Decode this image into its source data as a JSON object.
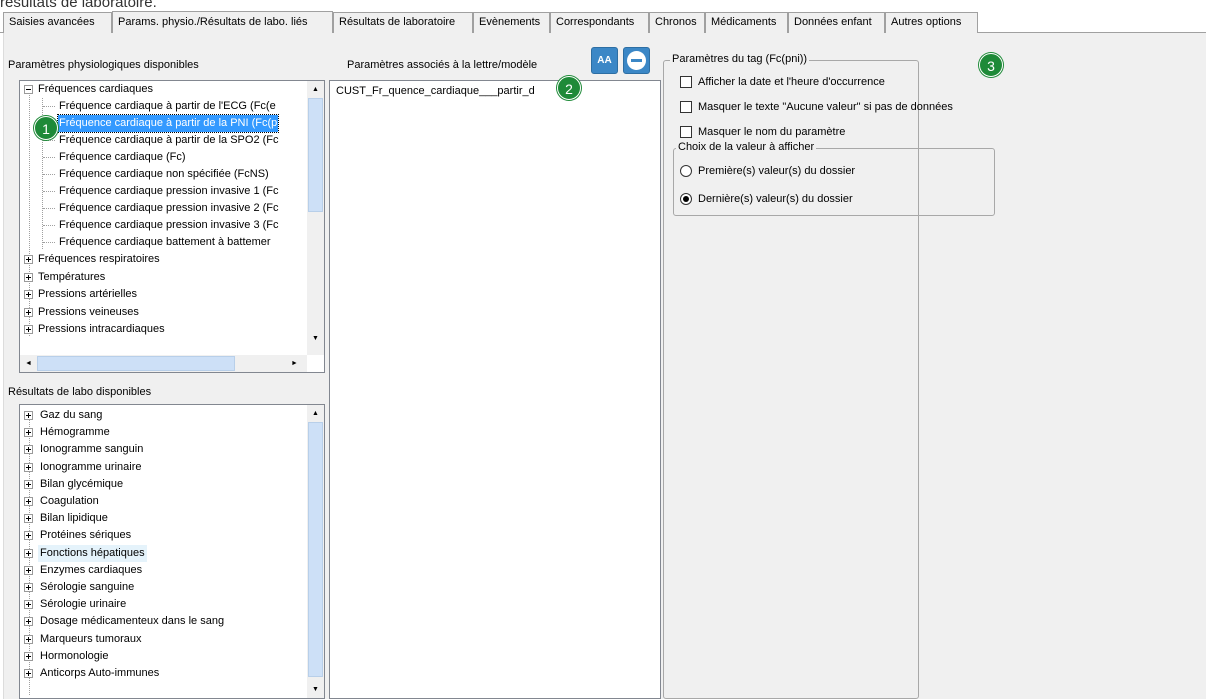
{
  "caption": "résultats de laboratoire.",
  "tabs": [
    {
      "label": "Saisies avancées"
    },
    {
      "label": "Params. physio./Résultats de labo. liés",
      "active": true
    },
    {
      "label": "Résultats de laboratoire"
    },
    {
      "label": "Evènements"
    },
    {
      "label": "Correspondants"
    },
    {
      "label": "Chronos"
    },
    {
      "label": "Médicaments"
    },
    {
      "label": "Données enfant"
    },
    {
      "label": "Autres options"
    }
  ],
  "physio": {
    "title": "Paramètres physiologiques disponibles",
    "expanded_group": "Fréquences cardiaques",
    "children": [
      "Fréquence cardiaque à partir de l'ECG (Fc(e",
      "Fréquence cardiaque à partir de la PNI (Fc(p",
      "Fréquence cardiaque à partir de la SPO2 (Fc",
      "Fréquence cardiaque (Fc)",
      "Fréquence cardiaque non spécifiée (FcNS)",
      "Fréquence cardiaque pression invasive 1 (Fc",
      "Fréquence cardiaque pression invasive 2 (Fc",
      "Fréquence cardiaque pression invasive 3 (Fc",
      "Fréquence cardiaque battement à battemer"
    ],
    "selected_index": 1,
    "groups": [
      "Fréquences respiratoires",
      "Températures",
      "Pressions artérielles",
      "Pressions veineuses",
      "Pressions intracardiaques"
    ]
  },
  "labo": {
    "title": "Résultats de labo disponibles",
    "items": [
      "Gaz du sang",
      "Hémogramme",
      "Ionogramme sanguin",
      "Ionogramme urinaire",
      "Bilan glycémique",
      "Coagulation",
      "Bilan lipidique",
      "Protéines sériques",
      "Fonctions hépatiques",
      "Enzymes cardiaques",
      "Sérologie sanguine",
      "Sérologie urinaire",
      "Dosage médicamenteux dans le sang",
      "Marqueurs tumoraux",
      "Hormonologie",
      "Anticorps Auto-immunes"
    ],
    "hovered_index": 8
  },
  "associated": {
    "title": "Paramètres associés à la lettre/modèle",
    "items": [
      "CUST_Fr_quence_cardiaque___partir_d"
    ],
    "aa_label": "AA"
  },
  "tag": {
    "title": "Paramètres du tag (Fc(pni))",
    "checks": [
      {
        "label": "Afficher la date et l'heure d'occurrence",
        "checked": false
      },
      {
        "label": "Masquer le texte \"Aucune valeur\" si pas de données",
        "checked": false
      },
      {
        "label": "Masquer le nom du paramètre",
        "checked": false
      }
    ],
    "choice_title": "Choix de la valeur à afficher",
    "radios": [
      {
        "label": "Première(s) valeur(s) du dossier",
        "selected": false
      },
      {
        "label": "Dernière(s) valeur(s) du dossier",
        "selected": true
      }
    ]
  },
  "badges": [
    "1",
    "2",
    "3"
  ],
  "scroll": {
    "up": "▲",
    "down": "▼",
    "left": "◄",
    "right": "►"
  }
}
